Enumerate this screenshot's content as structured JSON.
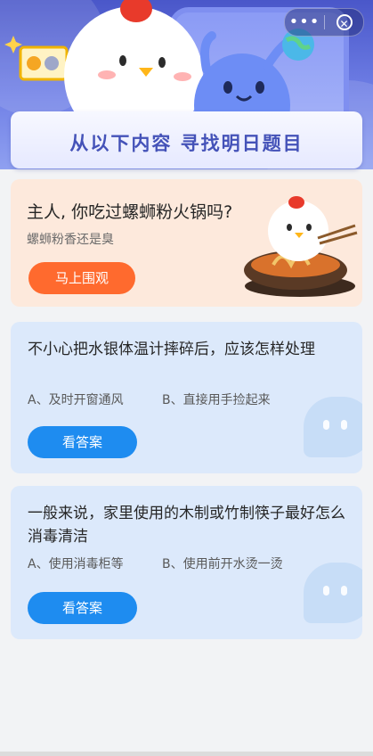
{
  "header": {
    "title": "从以下内容 寻找明日题目",
    "more_icon_label": "•••"
  },
  "promo": {
    "title": "主人, 你吃过螺蛳粉火锅吗?",
    "subtitle": "螺蛳粉香还是臭",
    "button_label": "马上围观"
  },
  "questions": [
    {
      "text": "不小心把水银体温计摔碎后，应该怎样处理",
      "option_a": "A、及时开窗通风",
      "option_b": "B、直接用手捡起来",
      "button_label": "看答案"
    },
    {
      "text": "一般来说，家里使用的木制或竹制筷子最好怎么消毒清洁",
      "option_a": "A、使用消毒柜等",
      "option_b": "B、使用前开水烫一烫",
      "button_label": "看答案"
    }
  ],
  "colors": {
    "header_blue": "#4a57c9",
    "accent_orange": "#ff6a2e",
    "accent_blue": "#1e8cf0",
    "promo_bg": "#fde9dc",
    "question_bg": "#dce9fb"
  }
}
